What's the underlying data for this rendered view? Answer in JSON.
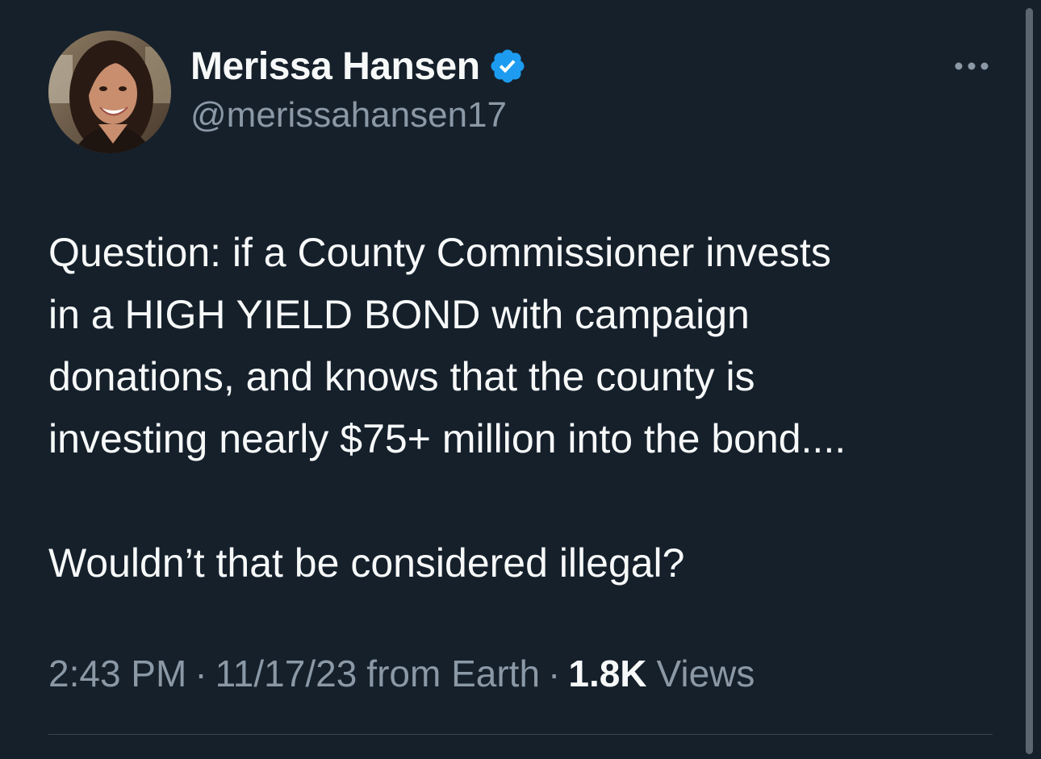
{
  "author": {
    "display_name": "Merissa Hansen",
    "handle": "@merissahansen17",
    "verified": true,
    "verified_badge_icon": "verified-badge-icon",
    "badge_color": "#1d9bf0"
  },
  "tweet": {
    "lines": [
      "Question: if a County Commissioner invests",
      "in a HIGH YIELD BOND with campaign",
      "donations, and knows that the county is",
      "investing nearly $75+ million into the bond....",
      "Wouldn’t that be considered illegal?"
    ]
  },
  "meta": {
    "time": "2:43 PM",
    "date": "11/17/23",
    "source": "from Earth",
    "separator": "·",
    "views_count": "1.8K",
    "views_label": "Views"
  },
  "icons": {
    "more": "more-options-icon"
  },
  "colors": {
    "background": "#15202b",
    "primary_text": "#f7f9f9",
    "secondary_text": "#8b98a5",
    "accent": "#1d9bf0"
  }
}
